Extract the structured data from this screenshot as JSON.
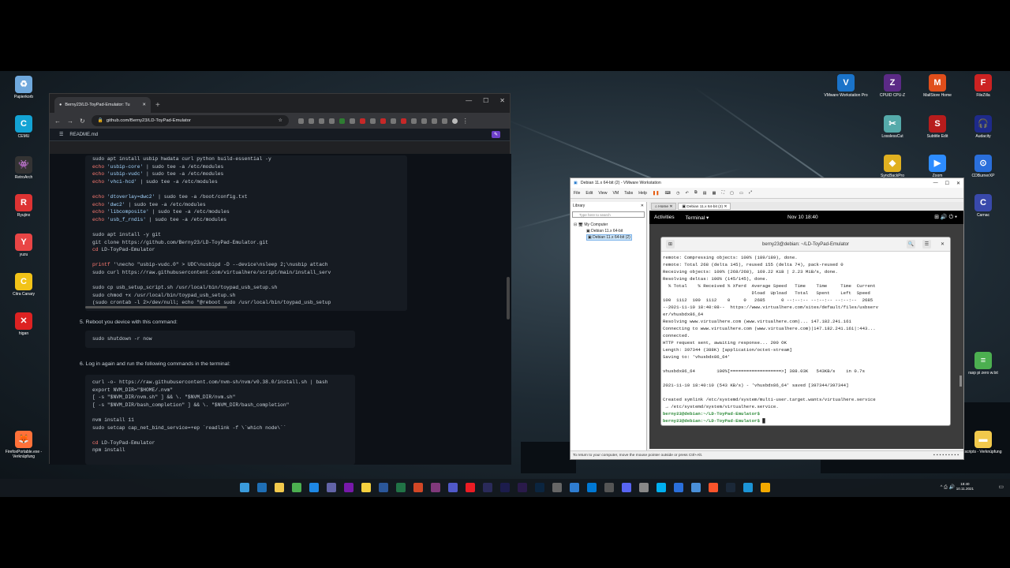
{
  "desktop_left_icons": [
    {
      "name": "recycle-bin-icon",
      "label": "Papierkorb",
      "color": "#6fa8dc",
      "glyph": "♻"
    },
    {
      "name": "cemu-icon",
      "label": "CEMU",
      "color": "#13a3d4",
      "glyph": "C"
    },
    {
      "name": "retroarch-icon",
      "label": "RetroArch",
      "color": "#333",
      "glyph": "👾"
    },
    {
      "name": "ryujinx-icon",
      "label": "Ryujinx",
      "color": "#d33",
      "glyph": "R"
    },
    {
      "name": "yuzu-icon",
      "label": "yuzu",
      "color": "#e94545",
      "glyph": "Y"
    },
    {
      "name": "citra-icon",
      "label": "Citra Canary",
      "color": "#f2c318",
      "glyph": "C"
    },
    {
      "name": "higan-icon",
      "label": "higan",
      "color": "#d22",
      "glyph": "✕"
    },
    {
      "name": "firefox-icon",
      "label": "FirefoxPortable.exe - Verknüpfung",
      "color": "#ff7139",
      "glyph": "🦊"
    }
  ],
  "desktop_right_icons": [
    {
      "name": "vmware-workstation-icon",
      "label": "VMware Workstation Pro",
      "color": "#1a73c9",
      "glyph": "V"
    },
    {
      "name": "cpuz-icon",
      "label": "CPUID CPU-Z",
      "color": "#5b2a86",
      "glyph": "Z"
    },
    {
      "name": "mailstore-icon",
      "label": "MailStore Home",
      "color": "#e04e1b",
      "glyph": "M"
    },
    {
      "name": "filezilla-icon",
      "label": "FileZilla",
      "color": "#c22",
      "glyph": "F"
    },
    {
      "name": "losslesscut-icon",
      "label": "LosslessCut",
      "color": "#5aa",
      "glyph": "✂"
    },
    {
      "name": "subtitle-edit-icon",
      "label": "Subtitle Edit",
      "color": "#b71c1c",
      "glyph": "S"
    },
    {
      "name": "audacity-icon",
      "label": "Audacity",
      "color": "#1e2a8a",
      "glyph": "🎧"
    },
    {
      "name": "syncbackpro-icon",
      "label": "SyncBackPro",
      "color": "#e0b020",
      "glyph": "◆"
    },
    {
      "name": "zoom-icon",
      "label": "Zoom",
      "color": "#2d8cff",
      "glyph": "▶"
    },
    {
      "name": "cdburnerxp-icon",
      "label": "CDBurnerXP",
      "color": "#2a6fdb",
      "glyph": "⊙"
    },
    {
      "name": "carnac-icon",
      "label": "Carnac",
      "color": "#3949ab",
      "glyph": "C"
    },
    {
      "name": "raspi-file-icon",
      "label": "rasp pi zero w.txt",
      "color": "#4caf50",
      "glyph": "≡"
    },
    {
      "name": "scripts-folder-icon",
      "label": "scripts - Verknüpfung",
      "color": "#f2c94c",
      "glyph": "▬"
    }
  ],
  "browser": {
    "tab_title": "Berny23/LD-ToyPad-Emulator: Tu",
    "url": "github.com/Berny23/LD-ToyPad-Emulator",
    "readme_label": "README.md",
    "code_block_1": [
      "sudo apt install usbip hwdata curl python build-essential -y",
      "echo 'usbip-core' | sudo tee -a /etc/modules",
      "echo 'usbip-vudc' | sudo tee -a /etc/modules",
      "echo 'vhci-hcd' | sudo tee -a /etc/modules",
      "",
      "echo 'dtoverlay=dwc2' | sudo tee -a /boot/config.txt",
      "echo 'dwc2' | sudo tee -a /etc/modules",
      "echo 'libcomposite' | sudo tee -a /etc/modules",
      "echo 'usb_f_rndis' | sudo tee -a /etc/modules",
      "",
      "sudo apt install -y git",
      "git clone https://github.com/Berny23/LD-ToyPad-Emulator.git",
      "cd LD-ToyPad-Emulator",
      "",
      "printf '\\necho \"usbip-vudc.0\" > UDC\\nusbipd -D --device\\nsleep 2;\\nusbip attach",
      "sudo curl https://raw.githubusercontent.com/virtualhere/script/main/install_serv",
      "",
      "sudo cp usb_setup_script.sh /usr/local/bin/toypad_usb_setup.sh",
      "sudo chmod +x /usr/local/bin/toypad_usb_setup.sh",
      "(sudo crontab -l 2>/dev/null; echo \"@reboot sudo /usr/local/bin/toypad_usb_setup"
    ],
    "step5": "5.  Reboot you device with this command:",
    "code_block_2": [
      "sudo shutdown -r now"
    ],
    "step6": "6.  Log in again and run the following commands in the terminal:",
    "code_block_3": [
      "curl -o- https://raw.githubusercontent.com/nvm-sh/nvm/v0.38.0/install.sh | bash",
      "export NVM_DIR=\"$HOME/.nvm\"",
      "[ -s \"$NVM_DIR/nvm.sh\" ] && \\. \"$NVM_DIR/nvm.sh\"",
      "[ -s \"$NVM_DIR/bash_completion\" ] && \\. \"$NVM_DIR/bash_completion\"",
      "",
      "nvm install 11",
      "sudo setcap cap_net_bind_service=+ep `readlink -f \\`which node\\``",
      "",
      "cd LD-ToyPad-Emulator",
      "npm install"
    ]
  },
  "vmware": {
    "title": "Debian 11.x 64-bit (2) - VMware Workstation",
    "menu": [
      "File",
      "Edit",
      "View",
      "VM",
      "Tabs",
      "Help"
    ],
    "library_label": "Library",
    "search_placeholder": "Type here to search",
    "tree": [
      "My Computer",
      "Debian 11.x 64-bit",
      "Debian 11.x 64-bit (2)"
    ],
    "tabs": [
      "Home",
      "Debian 11.x 64-bit (2)"
    ],
    "status": "To return to your computer, move the mouse pointer outside or press Ctrl+Alt.",
    "gnome": {
      "activities": "Activities",
      "app": "Terminal ▾",
      "clock": "Nov 10  18:40"
    },
    "terminal_title": "berny23@debian: ~/LD-ToyPad-Emulator",
    "terminal_lines": [
      "remote: Compressing objects: 100% (189/189), done.",
      "remote: Total 268 (delta 145), reused 155 (delta 74), pack-reused 0",
      "Receiving objects: 100% (268/268), 169.22 KiB | 2.23 MiB/s, done.",
      "Resolving deltas: 100% (145/145), done.",
      "  % Total    % Received % Xferd  Average Speed   Time    Time     Time  Current",
      "                                 Dload  Upload   Total   Spent    Left  Speed",
      "100  1112  100  1112    0     0   2685      0 --:--:-- --:--:-- --:--:--  2685",
      "--2021-11-10 18:40:08--  https://www.virtualhere.com/sites/default/files/usbserv",
      "er/vhusbdx86_64",
      "Resolving www.virtualhere.com (www.virtualhere.com)... 147.182.241.161",
      "Connecting to www.virtualhere.com (www.virtualhere.com)|147.182.241.161|:443...",
      "connected.",
      "HTTP request sent, awaiting response... 200 OK",
      "Length: 397344 (388K) [application/octet-stream]",
      "Saving to: 'vhusbdx86_64'",
      "",
      "vhusbdx86_64        100%[===================>] 388.03K   543KB/s    in 0.7s",
      "",
      "2021-11-10 18:40:10 (543 KB/s) - 'vhusbdx86_64' saved [397344/397344]",
      "",
      "Created symlink /etc/systemd/system/multi-user.target.wants/virtualhere.service",
      " → /etc/systemd/system/virtualhere.service."
    ],
    "prompt1": "berny23@debian:~/LD-ToyPad-Emulator$",
    "prompt2": "berny23@debian:~/LD-ToyPad-Emulator$"
  },
  "taskbar": {
    "time": "18:40",
    "date": "10.11.2021",
    "icons": [
      {
        "name": "start-icon",
        "color": "#3a9bdc"
      },
      {
        "name": "search-icon",
        "color": "#1f6fb5"
      },
      {
        "name": "file-explorer-icon",
        "color": "#f2c94c"
      },
      {
        "name": "chrome-icon",
        "color": "#4caf50"
      },
      {
        "name": "outlook-icon",
        "color": "#1e88e5"
      },
      {
        "name": "teams-icon",
        "color": "#6264a7"
      },
      {
        "name": "onenote-icon",
        "color": "#7719aa"
      },
      {
        "name": "norton-icon",
        "color": "#f4d03f"
      },
      {
        "name": "word-icon",
        "color": "#2b579a"
      },
      {
        "name": "excel-icon",
        "color": "#217346"
      },
      {
        "name": "powerpoint-icon",
        "color": "#d24726"
      },
      {
        "name": "onenote2-icon",
        "color": "#80397b"
      },
      {
        "name": "teams2-icon",
        "color": "#5059c9"
      },
      {
        "name": "acrobat-icon",
        "color": "#ec1c24"
      },
      {
        "name": "after-effects-icon",
        "color": "#2a2a5a"
      },
      {
        "name": "media-encoder-icon",
        "color": "#1c1c4c"
      },
      {
        "name": "premiere-icon",
        "color": "#2a1a4a"
      },
      {
        "name": "photoshop-icon",
        "color": "#0b2540"
      },
      {
        "name": "settings-icon",
        "color": "#666"
      },
      {
        "name": "maps-icon",
        "color": "#2f7dd1"
      },
      {
        "name": "vscode-icon",
        "color": "#0078d4"
      },
      {
        "name": "obs-icon",
        "color": "#555"
      },
      {
        "name": "discord-icon",
        "color": "#5865f2"
      },
      {
        "name": "messenger-icon",
        "color": "#888"
      },
      {
        "name": "skype-icon",
        "color": "#00aff0"
      },
      {
        "name": "visual-studio-icon",
        "color": "#2a6fdb"
      },
      {
        "name": "network-icon",
        "color": "#4a90d9"
      },
      {
        "name": "brave-icon",
        "color": "#fb542b"
      },
      {
        "name": "steam-icon",
        "color": "#1b2838"
      },
      {
        "name": "edge-icon",
        "color": "#1c94d6"
      },
      {
        "name": "vmware-taskbar-icon",
        "color": "#f2a900"
      }
    ]
  }
}
